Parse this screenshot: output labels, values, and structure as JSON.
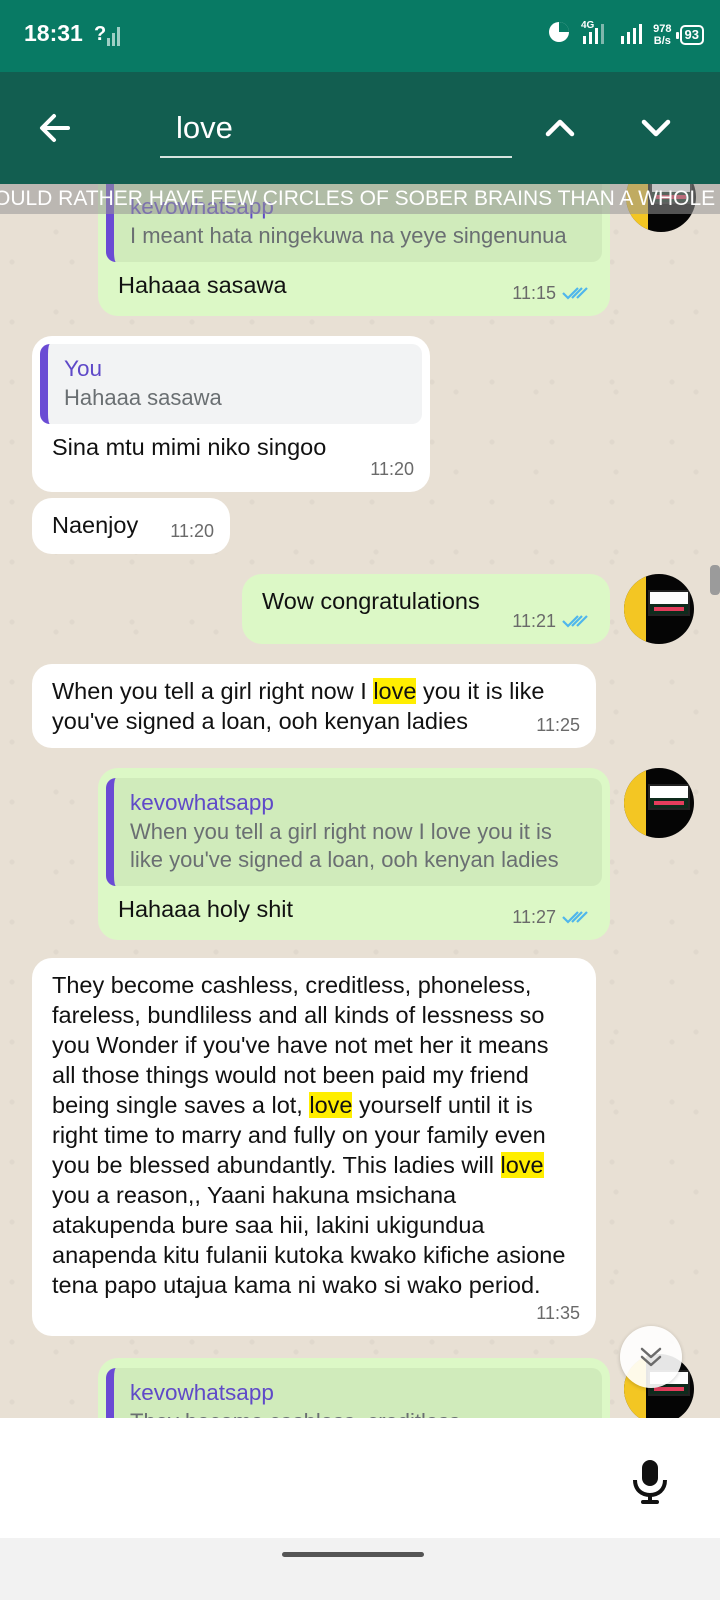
{
  "status_bar": {
    "time": "18:31",
    "sim_unknown": "?",
    "network_type": "4G",
    "net_speed_value": "978",
    "net_speed_unit": "B/s",
    "battery": "93"
  },
  "search": {
    "query": "love"
  },
  "ticker": {
    "text": "OULD RATHER HAVE FEW CIRCLES OF SOBER BRAINS THAN A WHOLE F"
  },
  "messages": [
    {
      "direction": "outgoing",
      "quote_author": "kevowhatsapp",
      "quote_text": "I meant hata ningekuwa na yeye singenunua",
      "text": "Hahaaa sasawa",
      "time": "11:15"
    },
    {
      "direction": "incoming",
      "quote_author": "You",
      "quote_text": "Hahaaa sasawa",
      "text": "Sina mtu mimi niko singoo",
      "time": "11:20"
    },
    {
      "direction": "incoming",
      "text": "Naenjoy",
      "time": "11:20"
    },
    {
      "direction": "outgoing",
      "text": "Wow congratulations",
      "time": "11:21"
    },
    {
      "direction": "incoming",
      "text_parts": [
        "When you tell a girl right now I ",
        "love",
        " you it is like you've signed a loan, ooh kenyan ladies"
      ],
      "time": "11:25"
    },
    {
      "direction": "outgoing",
      "quote_author": "kevowhatsapp",
      "quote_text": "When you tell a girl right now I love you it is like you've signed a loan, ooh kenyan ladies",
      "text": "Hahaaa holy shit",
      "time": "11:27"
    },
    {
      "direction": "incoming",
      "text_parts": [
        "They become cashless, creditless, phoneless, fareless, bundliless and all kinds of lessness so you Wonder if you've have not met her it means all those things would not been paid my friend being single saves a lot, ",
        "love",
        " yourself until it is right time to marry and fully on your family even you be blessed abundantly. This ladies will ",
        "love",
        " you a reason,, Yaani hakuna msichana atakupenda bure saa hii, lakini ukigundua anapenda kitu fulanii kutoka kwako kifiche asione tena papo utajua kama ni wako si wako period."
      ],
      "time": "11:35"
    },
    {
      "direction": "outgoing",
      "quote_author": "kevowhatsapp",
      "quote_text": "They become cashless, creditless,"
    }
  ],
  "colors": {
    "status_bar": "#087a64",
    "toolbar": "#125e50",
    "outgoing_bubble": "#dcf8c6",
    "incoming_bubble": "#ffffff",
    "quote_author": "#5f49c8",
    "read_ticks": "#4fb6ec",
    "search_highlight": "#ffee00"
  }
}
